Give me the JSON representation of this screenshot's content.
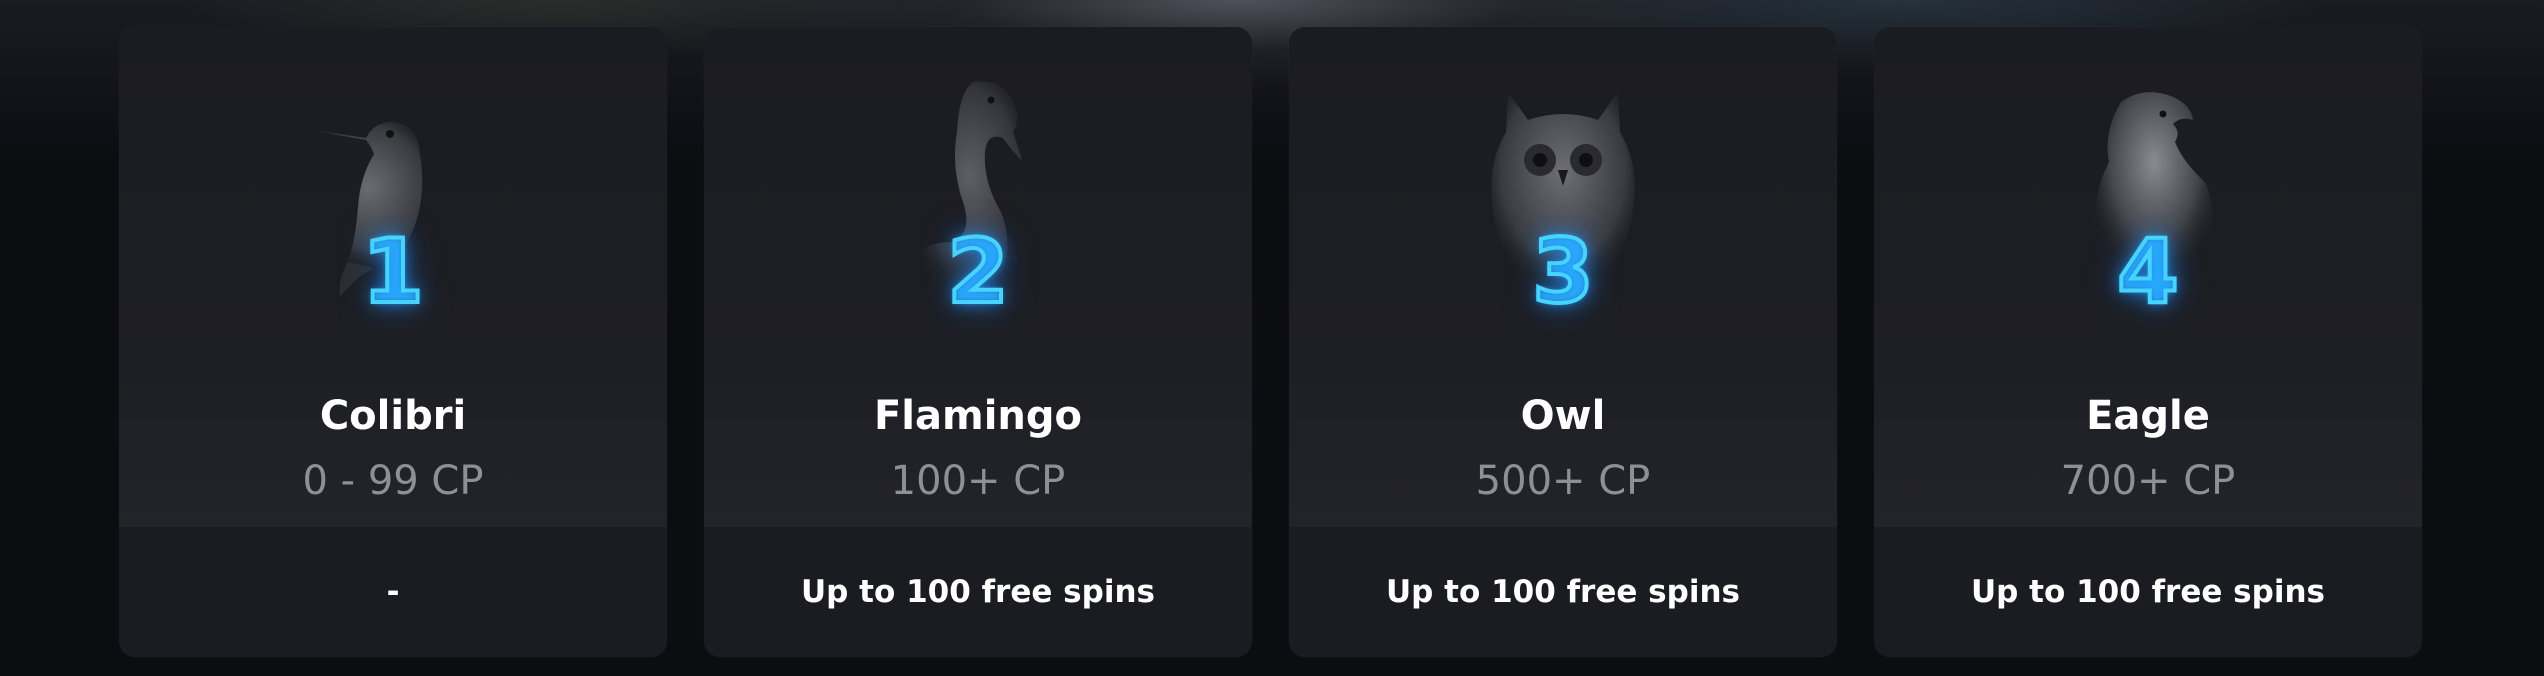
{
  "tiers": [
    {
      "icon": "colibri-icon",
      "number": "1",
      "name": "Colibri",
      "points": "0 - 99 CP",
      "reward": "-"
    },
    {
      "icon": "flamingo-icon",
      "number": "2",
      "name": "Flamingo",
      "points": "100+ CP",
      "reward": "Up to 100 free spins"
    },
    {
      "icon": "owl-icon",
      "number": "3",
      "name": "Owl",
      "points": "500+ CP",
      "reward": "Up to 100 free spins"
    },
    {
      "icon": "eagle-icon",
      "number": "4",
      "name": "Eagle",
      "points": "700+ CP",
      "reward": "Up to 100 free spins"
    }
  ],
  "colors": {
    "background": "#0c0d11",
    "card": "#1d1e23",
    "card_footer": "#1b1c21",
    "neon_number": "#46d4ff",
    "name_text": "#ffffff",
    "points_text": "#8e9096"
  }
}
